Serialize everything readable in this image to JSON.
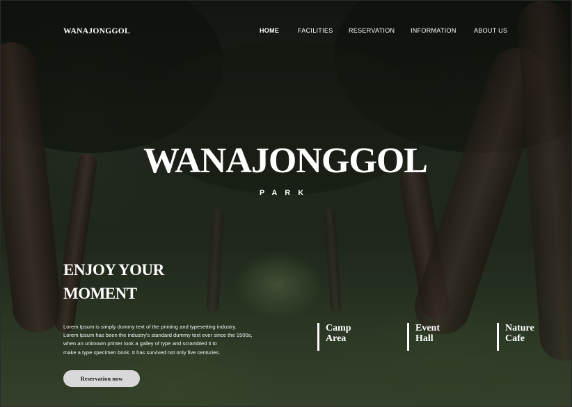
{
  "brand": "WANAJONGGOL",
  "nav": {
    "items": [
      "HOME",
      "FACILITIES",
      "RESERVATION",
      "INFORMATION",
      "ABOUT US"
    ],
    "active": "HOME"
  },
  "hero": {
    "title": "WANAJONGGOL",
    "subtitle": "PARK"
  },
  "intro": {
    "headline_line1": "ENJOY YOUR",
    "headline_line2": "MOMENT",
    "body_lines": [
      "Lorem Ipsum is simply dummy text of the printing and typesetting industry.",
      "Lorem Ipsum has been the industry's standard dummy text ever since the 1500s,",
      "when an unknown printer took a galley of type and scrambled it to",
      "make a type specimen book. It has survived not only five centuries."
    ],
    "cta_label": "Reservation now"
  },
  "facilities": [
    {
      "line1": "Camp",
      "line2": "Area"
    },
    {
      "line1": "Event",
      "line2": "Hall"
    },
    {
      "line1": "Nature",
      "line2": "Cafe"
    }
  ],
  "colors": {
    "text": "#ffffff",
    "button_bg": "#d9d9d9",
    "button_text": "#1a1a1a"
  }
}
